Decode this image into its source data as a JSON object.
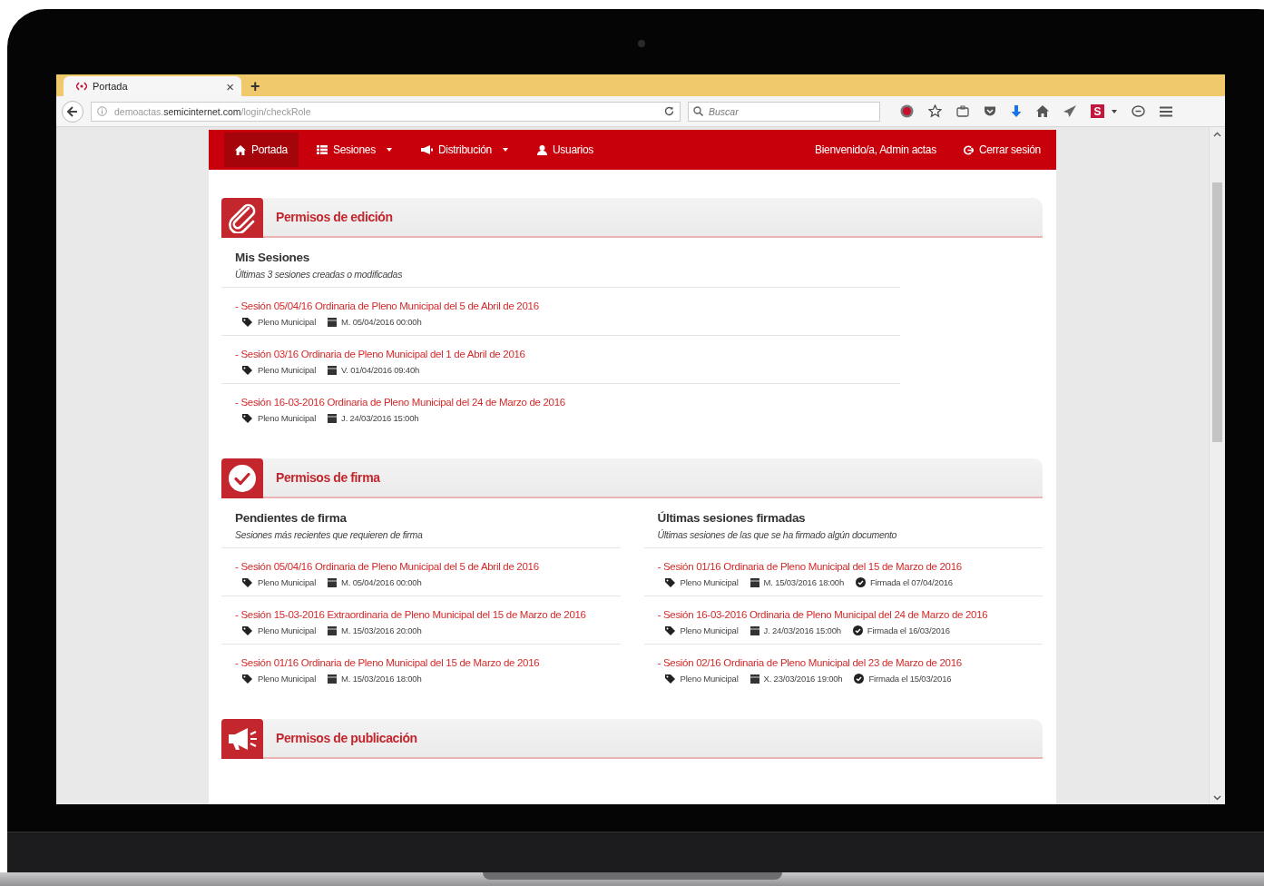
{
  "browser": {
    "tab": {
      "title": "Portada",
      "close": "×",
      "selected": true
    },
    "new_tab": "+",
    "address": {
      "subdomain": "demoactas.",
      "domain": "semicinternet.com",
      "path": "/login/checkRole"
    },
    "search": {
      "placeholder": "Buscar"
    },
    "extension_badge": "S"
  },
  "navbar": {
    "items": [
      {
        "label": "Portada",
        "kind": "home",
        "dropdown": false,
        "selected": true
      },
      {
        "label": "Sesiones",
        "kind": "list",
        "dropdown": true,
        "selected": false
      },
      {
        "label": "Distribución",
        "kind": "megaphone",
        "dropdown": true,
        "selected": false
      },
      {
        "label": "Usuarios",
        "kind": "user",
        "dropdown": false,
        "selected": false
      }
    ],
    "welcome": "Bienvenido/a, Admin actas",
    "logout": "Cerrar sesión"
  },
  "sections": [
    {
      "title": "Permisos de edición",
      "kind": "edit",
      "columns": [
        {
          "heading": "Mis Sesiones",
          "subtitle": "Últimas 3 sesiones creadas o modificadas",
          "sessions": [
            {
              "title": "- Sesión 05/04/16 Ordinaria de Pleno Municipal del 5 de Abril de 2016",
              "body": "Pleno Municipal",
              "date": "M. 05/04/2016 00:00h"
            },
            {
              "title": "- Sesión 03/16 Ordinaria de Pleno Municipal del 1 de Abril de 2016",
              "body": "Pleno Municipal",
              "date": "V. 01/04/2016 09:40h"
            },
            {
              "title": "- Sesión 16-03-2016 Ordinaria de Pleno Municipal del 24 de Marzo de 2016",
              "body": "Pleno Municipal",
              "date": "J. 24/03/2016 15:00h"
            }
          ]
        }
      ]
    },
    {
      "title": "Permisos de firma",
      "kind": "sign",
      "columns": [
        {
          "heading": "Pendientes de firma",
          "subtitle": "Sesiones más recientes que requieren de firma",
          "sessions": [
            {
              "title": "- Sesión 05/04/16 Ordinaria de Pleno Municipal del 5 de Abril de 2016",
              "body": "Pleno Municipal",
              "date": "M. 05/04/2016 00:00h"
            },
            {
              "title": "- Sesión 15-03-2016 Extraordinaria de Pleno Municipal del 15 de Marzo de 2016",
              "body": "Pleno Municipal",
              "date": "M. 15/03/2016 20:00h"
            },
            {
              "title": "- Sesión 01/16 Ordinaria de Pleno Municipal del 15 de Marzo de 2016",
              "body": "Pleno Municipal",
              "date": "M. 15/03/2016 18:00h"
            }
          ]
        },
        {
          "heading": "Últimas sesiones firmadas",
          "subtitle": "Últimas sesiones de las que se ha firmado algún documento",
          "sessions": [
            {
              "title": "- Sesión 01/16 Ordinaria de Pleno Municipal del 15 de Marzo de 2016",
              "body": "Pleno Municipal",
              "date": "M. 15/03/2016 18:00h",
              "signed": "Firmada el 07/04/2016"
            },
            {
              "title": "- Sesión 16-03-2016 Ordinaria de Pleno Municipal del 24 de Marzo de 2016",
              "body": "Pleno Municipal",
              "date": "J. 24/03/2016 15:00h",
              "signed": "Firmada el 16/03/2016"
            },
            {
              "title": "- Sesión 02/16 Ordinaria de Pleno Municipal del 23 de Marzo de 2016",
              "body": "Pleno Municipal",
              "date": "X. 23/03/2016 19:00h",
              "signed": "Firmada el 15/03/2016"
            }
          ]
        }
      ]
    },
    {
      "title": "Permisos de publicación",
      "kind": "publish"
    }
  ]
}
